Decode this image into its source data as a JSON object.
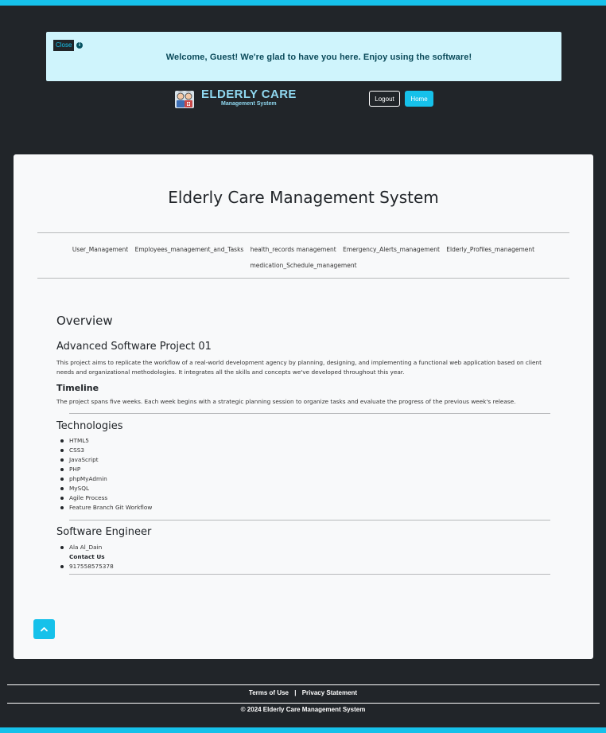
{
  "alert": {
    "close_label": "Close",
    "info_icon": "info-circle-icon",
    "message": "Welcome, Guest! We're glad to have you here. Enjoy using the software!"
  },
  "brand": {
    "logo_icon": "elderly-care-logo-icon",
    "title": "ELDERLY CARE",
    "subtitle": "Management System"
  },
  "header": {
    "logout_label": "Logout",
    "home_label": "Home"
  },
  "page": {
    "title": "Elderly Care Management System",
    "nav": [
      "User_Management",
      "Employees_management_and_Tasks",
      "health_records management",
      "Emergency_Alerts_management",
      "Elderly_Profiles_management",
      "medication_Schedule_management"
    ]
  },
  "overview": {
    "heading": "Overview",
    "project_heading": "Advanced Software Project 01",
    "project_text": "This project aims to replicate the workflow of a real-world development agency by planning, designing, and implementing a functional web application based on client needs and organizational methodologies. It integrates all the skills and concepts we've developed throughout this year.",
    "timeline_heading": "Timeline",
    "timeline_text": "The project spans five weeks. Each week begins with a strategic planning session to organize tasks and evaluate the progress of the previous week's release.",
    "tech_heading": "Technologies",
    "technologies": [
      "HTML5",
      "CSS3",
      "JavaScript",
      "PHP",
      "phpMyAdmin",
      "MySQL",
      "Agile Process",
      "Feature Branch Git Workflow"
    ],
    "engineer_heading": "Software Engineer",
    "engineer_name": "Ala Al_Dain",
    "contact_label": "Contact Us",
    "phone": "917558575378"
  },
  "scroll_top_icon": "chevron-up-icon",
  "footer": {
    "terms": "Terms of Use",
    "separator": "|",
    "privacy": "Privacy Statement",
    "copyright": "© 2024 Elderly Care Management System"
  },
  "colors": {
    "background": "#212529",
    "accent": "#16c1ea",
    "alert_bg": "#cff4fc",
    "card_bg": "#f8f9fa"
  }
}
